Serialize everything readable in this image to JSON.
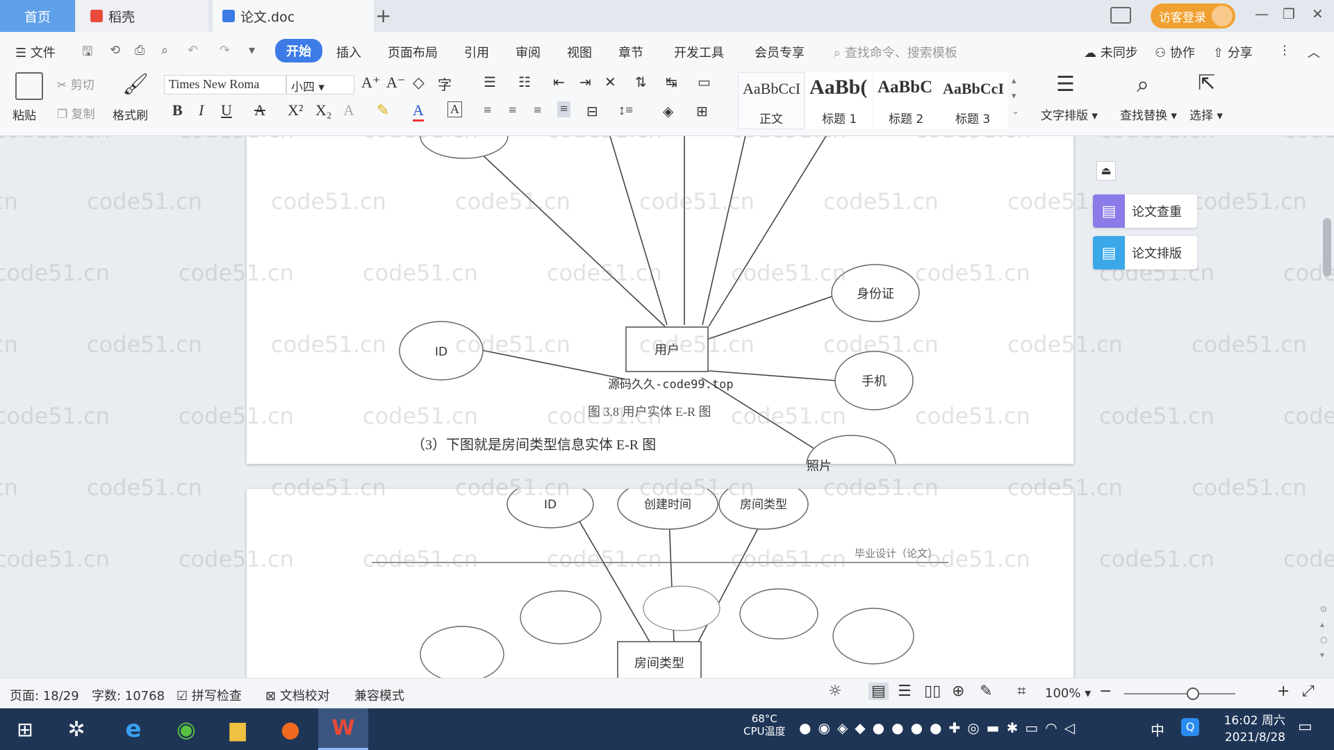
{
  "tabs": {
    "home": "首页",
    "daoke": "稻壳",
    "doc": "论文.doc"
  },
  "titlebar": {
    "login": "访客登录"
  },
  "menu": {
    "items": [
      "文件",
      "开始",
      "插入",
      "页面布局",
      "引用",
      "审阅",
      "视图",
      "章节",
      "开发工具",
      "会员专享"
    ],
    "search_placeholder": "查找命令、搜索模板",
    "sync": "未同步",
    "collab": "协作",
    "share": "分享"
  },
  "ribbon": {
    "paste": "粘贴",
    "cut": "剪切",
    "copy": "复制",
    "format_painter": "格式刷",
    "font_name": "Times New Roma",
    "font_size": "小四",
    "styles": [
      {
        "preview": "AaBbCcI",
        "label": "正文"
      },
      {
        "preview": "AaBb(",
        "label": "标题 1"
      },
      {
        "preview": "AaBbC",
        "label": "标题 2"
      },
      {
        "preview": "AaBbCcI",
        "label": "标题 3"
      }
    ],
    "text_layout": "文字排版",
    "find_replace": "查找替换",
    "select": "选择"
  },
  "document": {
    "page1": {
      "entities": {
        "user": "用户"
      },
      "attributes": [
        "ID",
        "身份证",
        "手机",
        "照片"
      ],
      "watermark_line": "源码久久-code99.top",
      "caption": "图 3.8 用户实体 E-R 图",
      "paragraph": "（3）下图就是房间类型信息实体 E-R 图"
    },
    "page2": {
      "header": "毕业设计（论文）",
      "entities": {
        "room_type": "房间类型"
      },
      "attributes": [
        "ID",
        "创建时间",
        "房间类型"
      ]
    }
  },
  "watermark": "code51.cn",
  "side_panel": {
    "check": "论文查重",
    "layout": "论文排版"
  },
  "statusbar": {
    "page": "页面: 18/29",
    "words": "字数: 10768",
    "spell": "拼写检查",
    "proof": "文档校对",
    "compat": "兼容模式",
    "zoom": "100%"
  },
  "taskbar": {
    "temp": "68°C",
    "temp_label": "CPU温度",
    "ime": "中",
    "time": "16:02 周六",
    "date": "2021/8/28"
  },
  "colors": {
    "accent": "#3d7be6",
    "login": "#f0a030",
    "taskbar": "#1f3556",
    "home_tab": "#5fa1e8"
  }
}
